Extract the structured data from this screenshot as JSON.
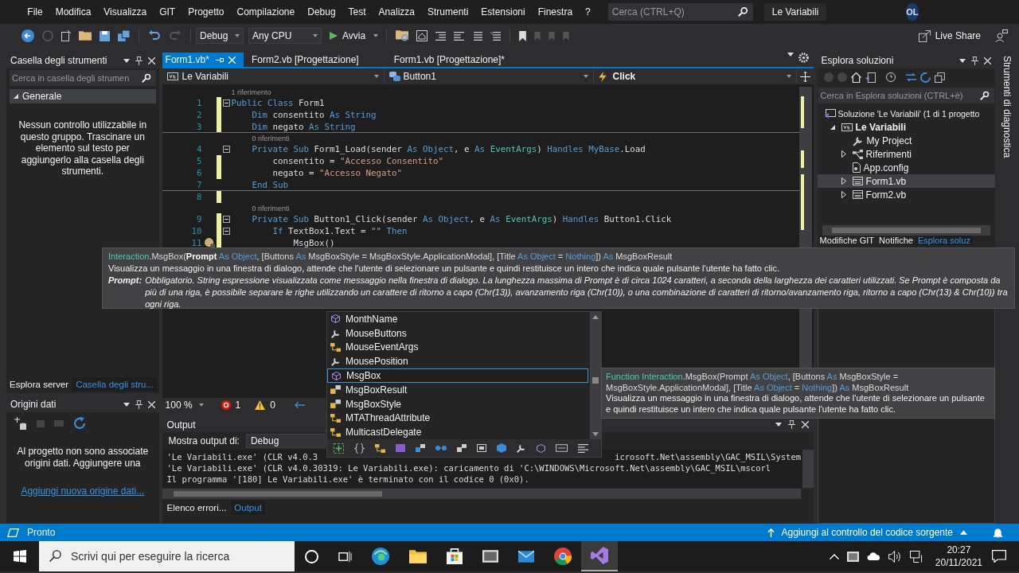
{
  "menu": {
    "items": [
      "File",
      "Modifica",
      "Visualizza",
      "GIT",
      "Progetto",
      "Compilazione",
      "Debug",
      "Test",
      "Analizza",
      "Strumenti",
      "Estensioni",
      "Finestra",
      "?"
    ],
    "search": {
      "placeholder": "Cerca (CTRL+Q)"
    },
    "solution_name": "Le Variabili",
    "avatar": "OL"
  },
  "toolbar": {
    "configuration": "Debug",
    "platform": "Any CPU",
    "start": "Avvia",
    "live_share": "Live Share"
  },
  "toolbox": {
    "title": "Casella degli strumenti",
    "search": {
      "placeholder": "Cerca in casella degli strumen"
    },
    "group": {
      "label": "Generale",
      "expanded": true
    },
    "message": "Nessun controllo utilizzabile in questo gruppo. Trascinare un elemento sul testo per aggiungerlo alla casella degli strumenti.",
    "tabs": [
      {
        "label": "Esplora server",
        "selected": false
      },
      {
        "label": "Casella degli stru...",
        "selected": true
      }
    ]
  },
  "data_sources": {
    "title": "Origini dati",
    "message": "Al progetto non sono associate origini dati. Aggiungere una",
    "link": "Aggiungi nuova origine dati..."
  },
  "editor": {
    "tabs": [
      {
        "label": "Form1.vb*",
        "selected": true
      },
      {
        "label": "Form2.vb [Progettazione]",
        "selected": false
      },
      {
        "label": "Form1.vb [Progettazione]*",
        "selected": false
      }
    ],
    "nav": [
      "Le Variabili",
      "Button1",
      "Click"
    ],
    "lines": [
      {
        "number": "1",
        "lens": "1 riferimento",
        "fold": true,
        "changed": true,
        "separator": false,
        "hint": false,
        "tokens": [
          {
            "kind": "kw",
            "text": "Public Class "
          },
          {
            "kind": "plain",
            "text": "Form1"
          }
        ]
      },
      {
        "number": "2",
        "fold": false,
        "changed": true,
        "separator": false,
        "hint": false,
        "tokens": [
          {
            "kind": "kw",
            "text": "    Dim "
          },
          {
            "kind": "plain",
            "text": "consentito "
          },
          {
            "kind": "kw",
            "text": "As String"
          }
        ]
      },
      {
        "number": "3",
        "fold": false,
        "changed": true,
        "separator": true,
        "hint": false,
        "tokens": [
          {
            "kind": "kw",
            "text": "    Dim "
          },
          {
            "kind": "plain",
            "text": "negato "
          },
          {
            "kind": "kw",
            "text": "As String"
          }
        ]
      },
      {
        "number": "4",
        "lens": "0 riferimenti",
        "fold": true,
        "changed": false,
        "separator": false,
        "hint": false,
        "tokens": [
          {
            "kind": "kw",
            "text": "    Private Sub "
          },
          {
            "kind": "plain",
            "text": "Form1_Load(sender "
          },
          {
            "kind": "kw",
            "text": "As Object"
          },
          {
            "kind": "plain",
            "text": ", e "
          },
          {
            "kind": "kw",
            "text": "As "
          },
          {
            "kind": "type",
            "text": "EventArgs"
          },
          {
            "kind": "plain",
            "text": ") "
          },
          {
            "kind": "kw",
            "text": "Handles MyBase"
          },
          {
            "kind": "plain",
            "text": ".Load"
          }
        ]
      },
      {
        "number": "5",
        "fold": false,
        "changed": true,
        "separator": false,
        "hint": false,
        "tokens": [
          {
            "kind": "plain",
            "text": "        consentito = "
          },
          {
            "kind": "str",
            "text": "\"Accesso Consentito\""
          }
        ]
      },
      {
        "number": "6",
        "fold": false,
        "changed": true,
        "separator": false,
        "hint": false,
        "tokens": [
          {
            "kind": "plain",
            "text": "        negato = "
          },
          {
            "kind": "str",
            "text": "\"Accesso Negato\""
          }
        ]
      },
      {
        "number": "7",
        "fold": false,
        "changed": false,
        "separator": true,
        "hint": false,
        "tokens": [
          {
            "kind": "kw",
            "text": "    End Sub"
          }
        ]
      },
      {
        "number": "8",
        "fold": false,
        "changed": true,
        "separator": false,
        "hint": false
      },
      {
        "number": "9",
        "lens": "0 riferimenti",
        "fold": true,
        "changed": true,
        "separator": false,
        "hint": false,
        "tokens": [
          {
            "kind": "kw",
            "text": "    Private Sub "
          },
          {
            "kind": "plain",
            "text": "Button1_Click(sender "
          },
          {
            "kind": "kw",
            "text": "As Object"
          },
          {
            "kind": "plain",
            "text": ", e "
          },
          {
            "kind": "kw",
            "text": "As "
          },
          {
            "kind": "type",
            "text": "EventArgs"
          },
          {
            "kind": "plain",
            "text": ") "
          },
          {
            "kind": "kw",
            "text": "Handles "
          },
          {
            "kind": "plain",
            "text": "Button1.Click"
          }
        ]
      },
      {
        "number": "10",
        "fold": true,
        "changed": true,
        "separator": false,
        "hint": false,
        "tokens": [
          {
            "kind": "kw",
            "text": "        If "
          },
          {
            "kind": "plain",
            "text": "TextBox1.Text = "
          },
          {
            "kind": "str",
            "text": "\"\""
          },
          {
            "kind": "kw",
            "text": " Then"
          }
        ]
      },
      {
        "number": "11",
        "fold": false,
        "changed": true,
        "separator": false,
        "hint": true,
        "tokens": [
          {
            "kind": "plain",
            "text": "            MsgBox()"
          }
        ]
      }
    ],
    "zoom": "100 %",
    "errors": "1",
    "warnings": "0"
  },
  "output": {
    "title": "Output",
    "source_label": "Mostra output di:",
    "source": "Debug",
    "first_line": {
      "start": "'Le Variabili.exe' (CLR v4.0.3",
      "end": "icrosoft.Net\\assembly\\GAC_MSIL\\System"
    },
    "lines": [
      "'Le Variabili.exe' (CLR v4.0.30319: Le Variabili.exe): caricamento di 'C:\\WINDOWS\\Microsoft.Net\\assembly\\GAC_MSIL\\mscorl",
      "Il programma '[180] Le Variabili.exe' è terminato con il codice 0 (0x0)."
    ],
    "tabs": [
      {
        "label": "Elenco errori...",
        "selected": false
      },
      {
        "label": "Output",
        "selected": true
      }
    ]
  },
  "solution": {
    "title": "Esplora soluzioni",
    "search": {
      "placeholder": "Cerca in Esplora soluzioni (CTRL+è)"
    },
    "tree": [
      {
        "label": "Soluzione 'Le Variabili' (1 di 1 progetto",
        "kind": "solution",
        "selected": false,
        "children": [
          {
            "label": "Le Variabili",
            "kind": "project",
            "selected": false,
            "expanded": true,
            "children": [
              {
                "label": "My Project",
                "kind": "settings",
                "selected": false
              },
              {
                "label": "Riferimenti",
                "kind": "references",
                "selected": false,
                "expanded": false
              },
              {
                "label": "App.config",
                "kind": "config",
                "selected": false
              },
              {
                "label": "Form1.vb",
                "kind": "form",
                "selected": true,
                "expanded": false
              },
              {
                "label": "Form2.vb",
                "kind": "form",
                "selected": false,
                "expanded": false
              }
            ]
          }
        ]
      }
    ],
    "tabs": [
      {
        "label": "Modifiche GIT",
        "selected": false
      },
      {
        "label": "Notifiche",
        "selected": false
      },
      {
        "label": "Esplora soluz",
        "selected": true
      }
    ]
  },
  "diagnostics_tab": "Strumenti di diagnostica",
  "param_info": {
    "signature": [
      {
        "kind": "type",
        "text": "Interaction"
      },
      {
        "kind": "plain",
        "text": ".MsgBox("
      },
      {
        "kind": "bold",
        "text": "Prompt"
      },
      {
        "kind": "kw",
        "text": " As Object"
      },
      {
        "kind": "plain",
        "text": ", [Buttons "
      },
      {
        "kind": "kw",
        "text": "As"
      },
      {
        "kind": "plain",
        "text": " MsgBoxStyle = MsgBoxStyle.ApplicationModal], [Title "
      },
      {
        "kind": "kw",
        "text": "As Object"
      },
      {
        "kind": "plain",
        "text": " = "
      },
      {
        "kind": "kw",
        "text": "Nothing"
      },
      {
        "kind": "plain",
        "text": "]) "
      },
      {
        "kind": "kw",
        "text": "As"
      },
      {
        "kind": "plain",
        "text": " MsgBoxResult"
      }
    ],
    "description": "Visualizza un messaggio in una finestra di dialogo, attende che l'utente di selezionare un pulsante e quindi restituisce un intero che indica quale pulsante l'utente ha fatto clic.",
    "param": {
      "name": "Prompt:",
      "text": "Obbligatorio. String espressione visualizzata come messaggio nella finestra di dialogo. La lunghezza massima di Prompt è di circa 1024 caratteri, a seconda della larghezza dei caratteri utilizzati. Se Prompt è composta da più di una riga, è possibile separare le righe utilizzando un carattere di ritorno a capo (Chr(13)), avanzamento riga (Chr(10)), o una combinazione di caratteri di ritorno/avanzamento riga, ritorno a capo (Chr(13) & Chr(10)) tra ogni riga."
    }
  },
  "completion": {
    "items": [
      {
        "label": "MonthName",
        "kind": "method",
        "selected": false
      },
      {
        "label": "MouseButtons",
        "kind": "property",
        "selected": false
      },
      {
        "label": "MouseEventArgs",
        "kind": "class",
        "selected": false
      },
      {
        "label": "MousePosition",
        "kind": "property",
        "selected": false
      },
      {
        "label": "MsgBox",
        "kind": "method",
        "selected": true
      },
      {
        "label": "MsgBoxResult",
        "kind": "enum",
        "selected": false
      },
      {
        "label": "MsgBoxStyle",
        "kind": "enum",
        "selected": false
      },
      {
        "label": "MTAThreadAttribute",
        "kind": "class",
        "selected": false
      },
      {
        "label": "MulticastDelegate",
        "kind": "class",
        "selected": false
      }
    ]
  },
  "quick_info": {
    "signature": [
      {
        "kind": "type",
        "text": "Function Interaction"
      },
      {
        "kind": "plain",
        "text": ".MsgBox(Prompt "
      },
      {
        "kind": "kw",
        "text": "As Object"
      },
      {
        "kind": "plain",
        "text": ", [Buttons "
      },
      {
        "kind": "kw",
        "text": "As"
      },
      {
        "kind": "plain",
        "text": " MsgBoxStyle = MsgBoxStyle.ApplicationModal], [Title "
      },
      {
        "kind": "kw",
        "text": "As Object"
      },
      {
        "kind": "plain",
        "text": " = "
      },
      {
        "kind": "kw",
        "text": "Nothing"
      },
      {
        "kind": "plain",
        "text": "]) "
      },
      {
        "kind": "kw",
        "text": "As"
      },
      {
        "kind": "plain",
        "text": " MsgBoxResult"
      }
    ],
    "description": "Visualizza un messaggio in una finestra di dialogo, attende che l'utente di selezionare un pulsante e quindi restituisce un intero che indica quale pulsante l'utente ha fatto clic."
  },
  "status": {
    "text": "Pronto",
    "source_control": "Aggiungi al controllo del codice sorgente"
  },
  "taskbar": {
    "search": {
      "placeholder": "Scrivi qui per eseguire la ricerca"
    },
    "time": "20:27",
    "date": "20/11/2021"
  }
}
